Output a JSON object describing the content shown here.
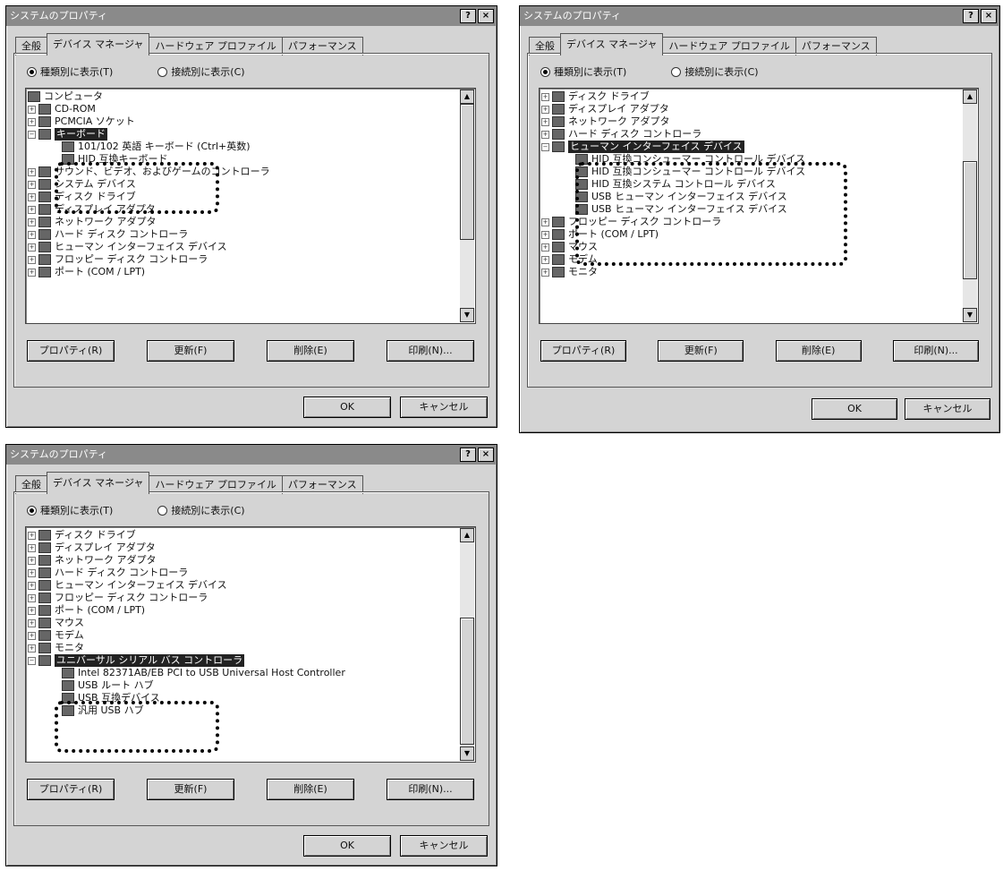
{
  "dialogs": [
    {
      "title": "システムのプロパティ",
      "title_buttons": [
        "?",
        "×"
      ],
      "tabs": [
        "全般",
        "デバイス マネージャ",
        "ハードウェア プロファイル",
        "パフォーマンス"
      ],
      "active_tab": 1,
      "radio_by_type": "種類別に表示(T)",
      "radio_by_connection": "接続別に表示(C)",
      "tree_items": [
        {
          "label": "コンピュータ",
          "icon": "computer-icon",
          "level": 0,
          "expander": "none"
        },
        {
          "label": "CD-ROM",
          "icon": "cdrom-icon",
          "level": 1,
          "expander": "+"
        },
        {
          "label": "PCMCIA ソケット",
          "icon": "pcmcia-icon",
          "level": 1,
          "expander": "+"
        },
        {
          "label": "キーボード",
          "icon": "keyboard-icon",
          "level": 1,
          "expander": "-",
          "selected": true
        },
        {
          "label": "101/102 英語 キーボード (Ctrl+英数)",
          "icon": "keyboard-icon",
          "level": 2,
          "expander": "none"
        },
        {
          "label": "HID 互換キーボード",
          "icon": "keyboard-icon",
          "level": 2,
          "expander": "none"
        },
        {
          "label": "サウンド、ビデオ、およびゲームのコントローラ",
          "icon": "sound-icon",
          "level": 1,
          "expander": "+"
        },
        {
          "label": "システム デバイス",
          "icon": "system-icon",
          "level": 1,
          "expander": "+"
        },
        {
          "label": "ディスク ドライブ",
          "icon": "disk-icon",
          "level": 1,
          "expander": "+"
        },
        {
          "label": "ディスプレイ アダプタ",
          "icon": "display-icon",
          "level": 1,
          "expander": "+"
        },
        {
          "label": "ネットワーク アダプタ",
          "icon": "network-icon",
          "level": 1,
          "expander": "+"
        },
        {
          "label": "ハード ディスク コントローラ",
          "icon": "controller-icon",
          "level": 1,
          "expander": "+"
        },
        {
          "label": "ヒューマン インターフェイス デバイス",
          "icon": "hid-icon",
          "level": 1,
          "expander": "+"
        },
        {
          "label": "フロッピー ディスク コントローラ",
          "icon": "floppy-icon",
          "level": 1,
          "expander": "+"
        },
        {
          "label": "ポート (COM / LPT)",
          "icon": "port-icon",
          "level": 1,
          "expander": "+"
        }
      ],
      "buttons": [
        "プロパティ(R)",
        "更新(F)",
        "削除(E)",
        "印刷(N)..."
      ],
      "ok": "OK",
      "cancel": "キャンセル"
    },
    {
      "title": "システムのプロパティ",
      "title_buttons": [
        "?",
        "×"
      ],
      "tabs": [
        "全般",
        "デバイス マネージャ",
        "ハードウェア プロファイル",
        "パフォーマンス"
      ],
      "active_tab": 1,
      "radio_by_type": "種類別に表示(T)",
      "radio_by_connection": "接続別に表示(C)",
      "tree_items": [
        {
          "label": "ディスク ドライブ",
          "icon": "disk-icon",
          "level": 1,
          "expander": "+"
        },
        {
          "label": "ディスプレイ アダプタ",
          "icon": "display-icon",
          "level": 1,
          "expander": "+"
        },
        {
          "label": "ネットワーク アダプタ",
          "icon": "network-icon",
          "level": 1,
          "expander": "+"
        },
        {
          "label": "ハード ディスク コントローラ",
          "icon": "controller-icon",
          "level": 1,
          "expander": "+"
        },
        {
          "label": "ヒューマン インターフェイス デバイス",
          "icon": "hid-icon",
          "level": 1,
          "expander": "-",
          "selected": true
        },
        {
          "label": "HID 互換コンシューマー コントロール デバイス",
          "icon": "hid-icon",
          "level": 2,
          "expander": "none"
        },
        {
          "label": "HID 互換コンシューマー コントロール デバイス",
          "icon": "hid-icon",
          "level": 2,
          "expander": "none"
        },
        {
          "label": "HID 互換システム コントロール デバイス",
          "icon": "hid-icon",
          "level": 2,
          "expander": "none"
        },
        {
          "label": "USB ヒューマン インターフェイス デバイス",
          "icon": "hid-icon",
          "level": 2,
          "expander": "none"
        },
        {
          "label": "USB ヒューマン インターフェイス デバイス",
          "icon": "hid-icon",
          "level": 2,
          "expander": "none"
        },
        {
          "label": "フロッピー ディスク コントローラ",
          "icon": "floppy-icon",
          "level": 1,
          "expander": "+"
        },
        {
          "label": "ポート (COM / LPT)",
          "icon": "port-icon",
          "level": 1,
          "expander": "+"
        },
        {
          "label": "マウス",
          "icon": "mouse-icon",
          "level": 1,
          "expander": "+"
        },
        {
          "label": "モデム",
          "icon": "modem-icon",
          "level": 1,
          "expander": "+"
        },
        {
          "label": "モニタ",
          "icon": "monitor-icon",
          "level": 1,
          "expander": "+"
        }
      ],
      "buttons": [
        "プロパティ(R)",
        "更新(F)",
        "削除(E)",
        "印刷(N)..."
      ],
      "ok": "OK",
      "cancel": "キャンセル"
    },
    {
      "title": "システムのプロパティ",
      "title_buttons": [
        "?",
        "×"
      ],
      "tabs": [
        "全般",
        "デバイス マネージャ",
        "ハードウェア プロファイル",
        "パフォーマンス"
      ],
      "active_tab": 1,
      "radio_by_type": "種類別に表示(T)",
      "radio_by_connection": "接続別に表示(C)",
      "tree_items": [
        {
          "label": "ディスク ドライブ",
          "icon": "disk-icon",
          "level": 1,
          "expander": "+"
        },
        {
          "label": "ディスプレイ アダプタ",
          "icon": "display-icon",
          "level": 1,
          "expander": "+"
        },
        {
          "label": "ネットワーク アダプタ",
          "icon": "network-icon",
          "level": 1,
          "expander": "+"
        },
        {
          "label": "ハード ディスク コントローラ",
          "icon": "controller-icon",
          "level": 1,
          "expander": "+"
        },
        {
          "label": "ヒューマン インターフェイス デバイス",
          "icon": "hid-icon",
          "level": 1,
          "expander": "+"
        },
        {
          "label": "フロッピー ディスク コントローラ",
          "icon": "floppy-icon",
          "level": 1,
          "expander": "+"
        },
        {
          "label": "ポート (COM / LPT)",
          "icon": "port-icon",
          "level": 1,
          "expander": "+"
        },
        {
          "label": "マウス",
          "icon": "mouse-icon",
          "level": 1,
          "expander": "+"
        },
        {
          "label": "モデム",
          "icon": "modem-icon",
          "level": 1,
          "expander": "+"
        },
        {
          "label": "モニタ",
          "icon": "monitor-icon",
          "level": 1,
          "expander": "+"
        },
        {
          "label": "ユニバーサル シリアル バス コントローラ",
          "icon": "usb-icon",
          "level": 1,
          "expander": "-",
          "selected": true
        },
        {
          "label": "Intel 82371AB/EB PCI to USB Universal Host Controller",
          "icon": "usb-icon",
          "level": 2,
          "expander": "none"
        },
        {
          "label": "USB ルート ハブ",
          "icon": "usb-icon",
          "level": 2,
          "expander": "none"
        },
        {
          "label": "USB 互換デバイス",
          "icon": "usb-icon",
          "level": 2,
          "expander": "none"
        },
        {
          "label": "汎用 USB ハブ",
          "icon": "usb-icon",
          "level": 2,
          "expander": "none"
        }
      ],
      "buttons": [
        "プロパティ(R)",
        "更新(F)",
        "削除(E)",
        "印刷(N)..."
      ],
      "ok": "OK",
      "cancel": "キャンセル"
    }
  ]
}
